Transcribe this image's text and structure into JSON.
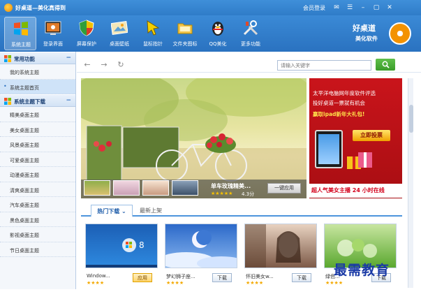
{
  "window": {
    "title": "好桌道—美化真得到",
    "member_login": "会员登录",
    "buttons": [
      "✉",
      "☰",
      "–",
      "▢",
      "✕"
    ]
  },
  "toolbar": {
    "items": [
      {
        "label": "系统主题",
        "icon": "windows-logo-icon",
        "active": true
      },
      {
        "label": "登录界面",
        "icon": "login-screen-icon"
      },
      {
        "label": "屏幕保护",
        "icon": "shield-icon"
      },
      {
        "label": "桌面壁纸",
        "icon": "wallpaper-icon"
      },
      {
        "label": "鼠标指针",
        "icon": "mouse-pointer-icon"
      },
      {
        "label": "文件夹图标",
        "icon": "folder-icon"
      },
      {
        "label": "QQ美化",
        "icon": "qq-penguin-icon"
      },
      {
        "label": "更多功能",
        "icon": "tools-icon"
      }
    ],
    "brand_line1": "好桌道",
    "brand_line2": "美化软件"
  },
  "sidebar": {
    "common_header": "常用功能",
    "common_items": [
      "我的系统主题",
      "系统主题首页"
    ],
    "selected_index": 1,
    "download_header": "系统主题下载",
    "download_items": [
      "精美桌面主题",
      "美女桌面主题",
      "风景桌面主题",
      "可爱桌面主题",
      "动漫桌面主题",
      "清爽桌面主题",
      "汽车桌面主题",
      "黑色桌面主题",
      "影视桌面主题",
      "节日桌面主题"
    ],
    "collapse_symbol": "−"
  },
  "nav": {
    "back": "←",
    "forward": "→",
    "refresh": "↻",
    "search_placeholder": "请输入关键字"
  },
  "banner": {
    "title": "单车玫瑰精美...",
    "stars": "★★★★★",
    "score": "4.3分",
    "apply_label": "一键应用"
  },
  "ad": {
    "line1": "太平洋电脑网年度软件评选",
    "line2": "投好桌道一票就有机会",
    "line3": "赢取ipad新年大礼包!",
    "vote_button": "立即投票",
    "footer": "超人气美女主播 24 小时在线"
  },
  "tabs": {
    "hot": "热门下载",
    "latest": "最新上架"
  },
  "cards": [
    {
      "name": "Window...",
      "stars": "★★★★",
      "button": "应用",
      "applied": true
    },
    {
      "name": "梦幻狮子座...",
      "stars": "★★★★",
      "button": "下载",
      "applied": false
    },
    {
      "name": "怀旧美女w...",
      "stars": "★★★★",
      "button": "下载",
      "applied": false
    },
    {
      "name": "绿色...",
      "stars": "★★★★",
      "button": "下载",
      "applied": false
    }
  ],
  "watermark": "最需教育",
  "colors": {
    "title_blue": "#2f7cc8",
    "search_green": "#3a9c2a",
    "ad_red": "#c9141b",
    "tab_blue": "#4d94dc"
  }
}
